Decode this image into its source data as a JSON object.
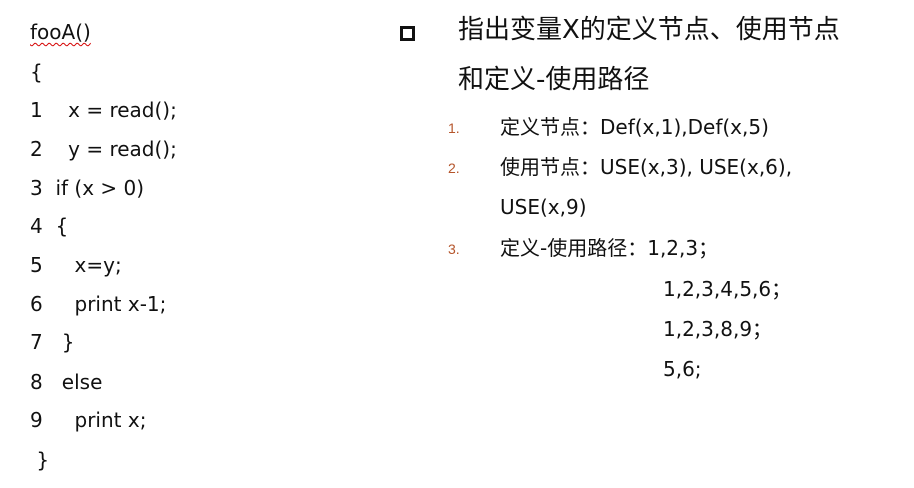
{
  "code": {
    "lines": [
      "fooA()",
      "{",
      "1    x = read();",
      "2    y = read();",
      "3  if (x > 0)",
      "4  {",
      "5     x=y;",
      "6     print x-1;",
      "7   }",
      "8   else",
      "9     print x;",
      " }"
    ]
  },
  "main": {
    "bullet_icon": "hollow-square-bullet",
    "heading_line1": "指出变量X的定义节点、使用节点",
    "heading_line2": "和定义-使用路径",
    "items": [
      {
        "number": "1.",
        "label": "定义节点：",
        "text": "Def(x,1),Def(x,5)"
      },
      {
        "number": "2.",
        "label": "使用节点：",
        "text": "USE(x,3), USE(x,6),",
        "text_cont": "USE(x,9)"
      },
      {
        "number": "3.",
        "label": "定义-使用路径：",
        "text": "1,2,3；"
      }
    ],
    "paths_cont": [
      "1,2,3,4,5,6；",
      "1,2,3,8,9；",
      "5,6;"
    ],
    "accent_color": "#b5552b"
  }
}
